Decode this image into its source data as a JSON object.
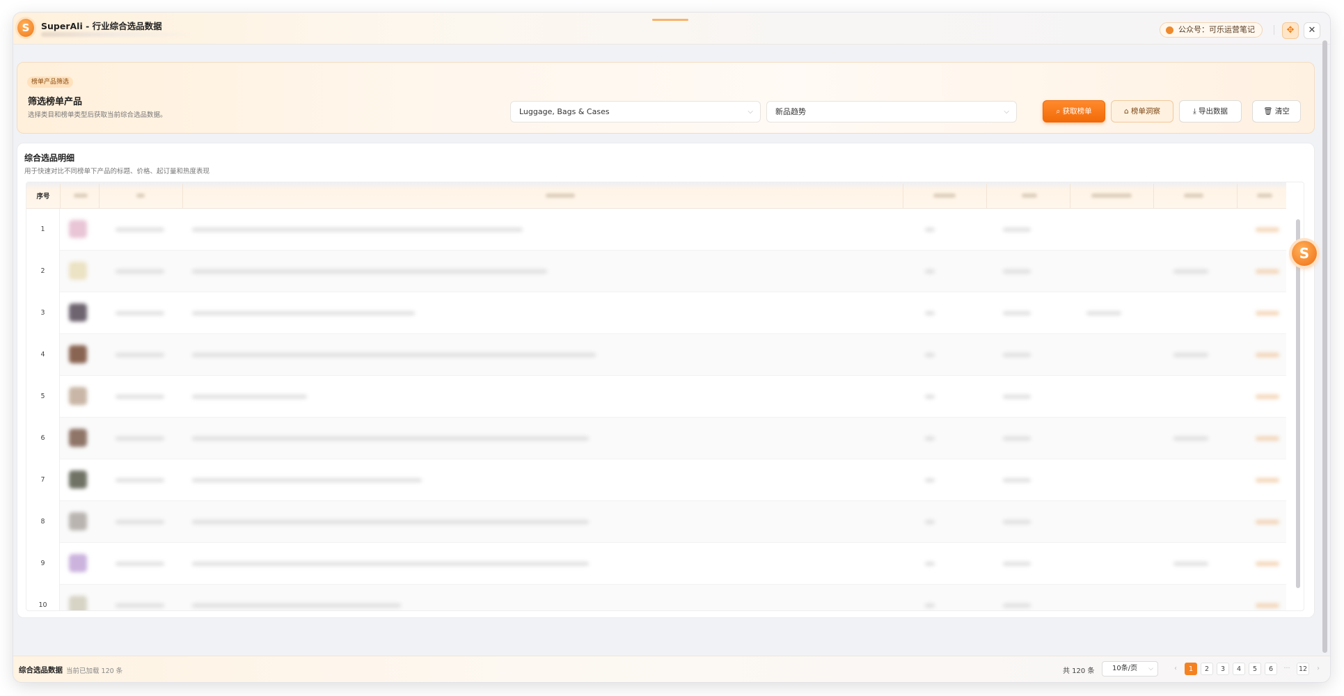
{
  "app": {
    "logo_letter": "S",
    "title": "SuperAli - 行业综合选品数据",
    "wechat_label": "公众号：可乐运营笔记",
    "pin_icon": "✥",
    "close_icon": "✕"
  },
  "filter": {
    "tag": "榜单产品筛选",
    "title": "筛选榜单产品",
    "description": "选择类目和榜单类型后获取当前综合选品数据。",
    "category_value": "Luggage, Bags & Cases",
    "type_value": "新品趋势",
    "fetch_label": "⌕ 获取榜单",
    "insight_label": "⌂ 榜单洞察",
    "export_label": "⤓ 导出数据",
    "clear_label": "🗑 清空"
  },
  "detail": {
    "title": "综合选品明细",
    "description": "用于快速对比不同榜单下产品的标题、价格、起订量和热度表现",
    "index_header": "序号",
    "rows": [
      "1",
      "2",
      "3",
      "4",
      "5",
      "6",
      "7",
      "8",
      "9",
      "10"
    ]
  },
  "footer": {
    "title": "综合选品数据",
    "loaded": "当前已加载 120 条",
    "total": "共 120 条",
    "page_size": "10条/页",
    "pages": [
      "1",
      "2",
      "3",
      "4",
      "5",
      "6",
      "···",
      "12"
    ],
    "prev": "‹",
    "next": "›",
    "active_page": "1"
  },
  "colors": {
    "accent": "#f58220",
    "accent_dark": "#f26a08",
    "tag_bg": "#ffe1bd"
  }
}
